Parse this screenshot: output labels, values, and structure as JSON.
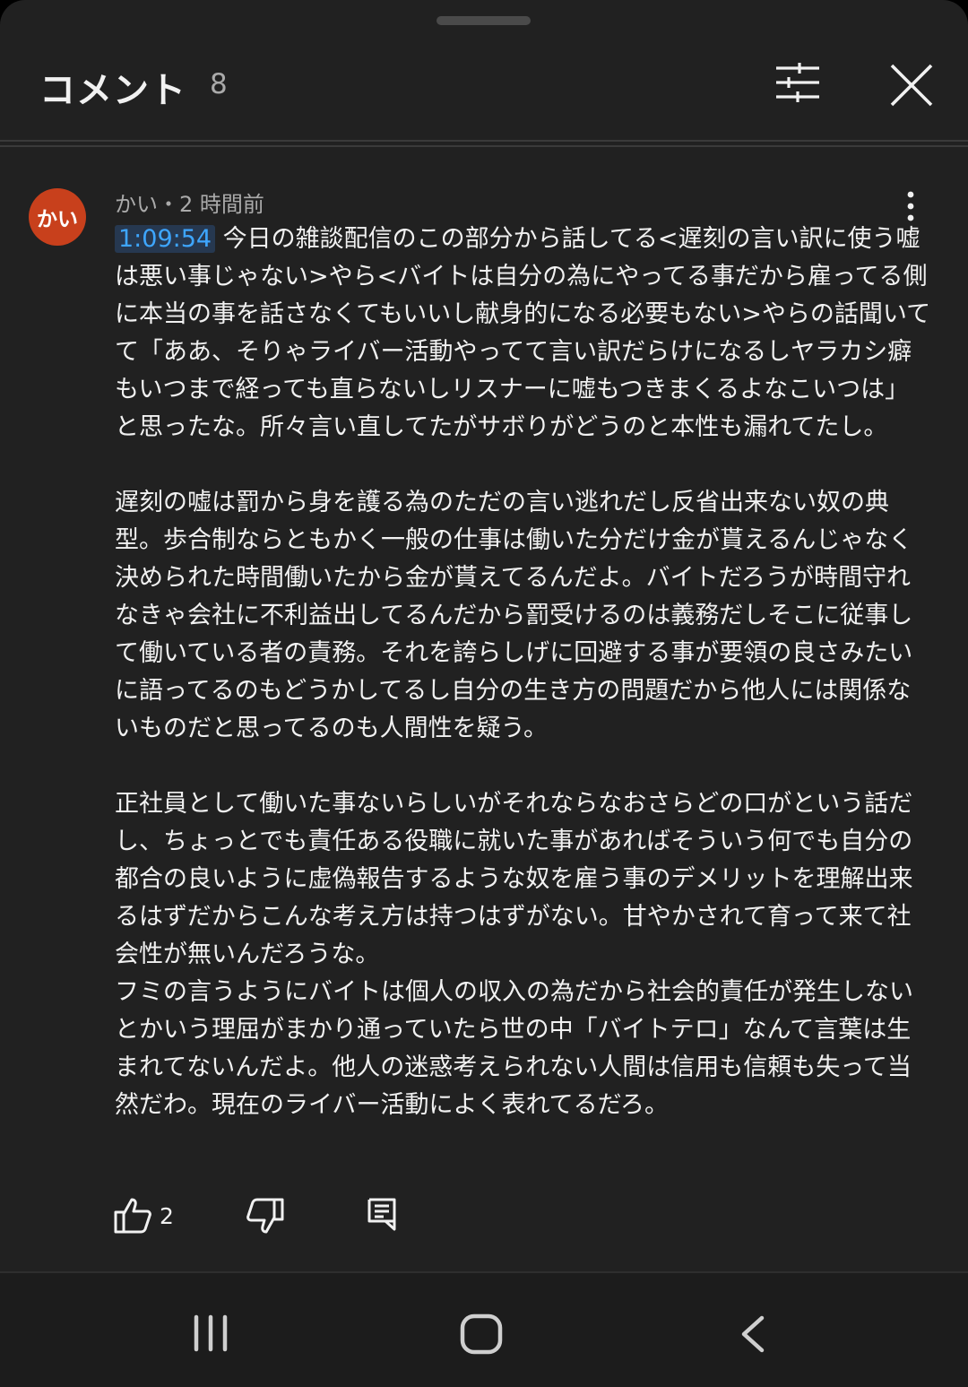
{
  "header": {
    "title": "コメント",
    "count": "8",
    "filter_icon": "tune-icon",
    "close_icon": "close-icon"
  },
  "comment": {
    "avatar_text": "かい",
    "avatar_color": "#c8401c",
    "meta": "かい・2 時間前",
    "timestamp_link": "1:09:54",
    "body": " 今日の雑談配信のこの部分から話してる<遅刻の言い訳に使う嘘は悪い事じゃない>やら<バイトは自分の為にやってる事だから雇ってる側に本当の事を話さなくてもいいし献身的になる必要もない>やらの話聞いてて「ああ、そりゃライバー活動やってて言い訳だらけになるしヤラカシ癖もいつまで経っても直らないしリスナーに嘘もつきまくるよなこいつは」と思ったな。所々言い直してたがサボりがどうのと本性も漏れてたし。\n\n遅刻の嘘は罰から身を護る為のただの言い逃れだし反省出来ない奴の典型。歩合制ならともかく一般の仕事は働いた分だけ金が貰えるんじゃなく決められた時間働いたから金が貰えてるんだよ。バイトだろうが時間守れなきゃ会社に不利益出してるんだから罰受けるのは義務だしそこに従事して働いている者の責務。それを誇らしげに回避する事が要領の良さみたいに語ってるのもどうかしてるし自分の生き方の問題だから他人には関係ないものだと思ってるのも人間性を疑う。\n\n正社員として働いた事ないらしいがそれならなおさらどの口がという話だし、ちょっとでも責任ある役職に就いた事があればそういう何でも自分の都合の良いように虚偽報告するような奴を雇う事のデメリットを理解出来るはずだからこんな考え方は持つはずがない。甘やかされて育って来て社会性が無いんだろうな。\nフミの言うようにバイトは個人の収入の為だから社会的責任が発生しないとかいう理屈がまかり通っていたら世の中「バイトテロ」なんて言葉は生まれてないんだよ。他人の迷惑考えられない人間は信用も信頼も失って当然だわ。現在のライバー活動によく表れてるだろ。",
    "like_count": "2",
    "icons": [
      "thumb-up-icon",
      "thumb-down-icon",
      "reply-icon",
      "more-vertical-icon"
    ]
  },
  "navbar": {
    "icons": [
      "recents-icon",
      "home-icon",
      "back-icon"
    ]
  },
  "colors": {
    "background": "#212121",
    "text": "#f1f1f1",
    "secondary_text": "#aaaaaa",
    "link": "#3ea6ff"
  }
}
